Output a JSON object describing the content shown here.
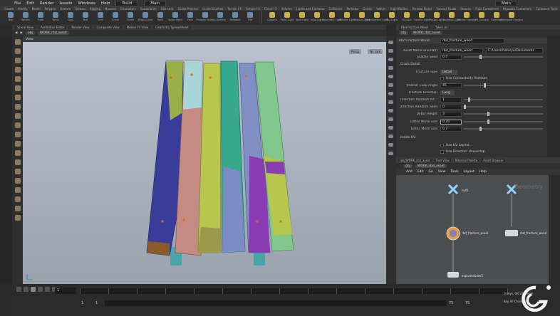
{
  "menubar": {
    "items": [
      "File",
      "Edit",
      "Render",
      "Assets",
      "Windows",
      "Help"
    ],
    "desktop": "Build",
    "context": "Main",
    "right_context": "Main"
  },
  "shelf_tabs": [
    "Create",
    "Modify",
    "Model",
    "Polygon",
    "Deform",
    "Texture",
    "Rigging",
    "Muscles",
    "Characters",
    "Constraints",
    "Hair Utils",
    "Guide Process",
    "Guide Brushes",
    "Terrain FX",
    "Simple FX",
    "Cloud FX",
    "Volume",
    "Lights and Cameras",
    "Collisions",
    "Particles",
    "Grains",
    "Vellum",
    "Rigid Bodies",
    "Particle Fluids",
    "Viscous Fluids",
    "Oceans",
    "Fluid Containers",
    "Populate Containers",
    "Container Tools",
    "Pyro FX",
    "Sparse Pyro FX",
    "FEM",
    "Wires",
    "Crowds",
    "Drive Simulation"
  ],
  "shelf_tools": [
    "Box",
    "Sphere",
    "Tube",
    "Torus",
    "Grid",
    "Null",
    "Line",
    "Circle",
    "Curve",
    "Draw Curve",
    "Path",
    "Spray Paint",
    "Font",
    "Platonic Solids",
    "L-System",
    "Metaball",
    "File"
  ],
  "light_tools": [
    "Camera",
    "Point Light",
    "Spot Light",
    "Area Light",
    "Geometry Light",
    "Volume Light",
    "Distant Light",
    "Environment Light",
    "Sky Light",
    "GI Light",
    "Caustic Light",
    "Portal Light",
    "Ambient Light",
    "Stereo Camera",
    "VR Camera",
    "Switcher",
    "Gamepad Camera"
  ],
  "pane_tabs": [
    "Scene View",
    "Animation Editor",
    "Render View",
    "Composite View",
    "Motion FX View",
    "Geometry Spreadsheet"
  ],
  "viewport": {
    "path": [
      "obj",
      "WORK_rbd_asset"
    ],
    "label": "View",
    "persp": "Persp",
    "cam": "No cam"
  },
  "params": {
    "tabs": [
      "Rbd Fracture Wood",
      "Take List"
    ],
    "node_type": "Rbd Fracture Wood",
    "node_name": "rbd_fracture_wood",
    "path_label": "Asset Name and Path",
    "path_value": "rbd_fracture_wood",
    "path_extra": "C:/Users/hataryo/Documents",
    "scatter_seed_label": "Scatter Seed",
    "scatter_seed": "0.7",
    "crack_section": "Crack Detail",
    "fracture_type_label": "Fracture Type",
    "fracture_type": "Detail",
    "connectivity_label": "Use Connectivity Partition",
    "cusp_label": "Interior Cusp Angle",
    "cusp": "45",
    "direction_label": "Fracture Direction",
    "direction": "Long",
    "rand_int_label": "Direction Random Int...",
    "rand_int": "1",
    "rand_seed_label": "Direction Random Seed",
    "rand_seed": "0",
    "height_label": "Detail Height",
    "height": "3",
    "noise_label": "Detail Noise Size",
    "noise": "0.35",
    "mesh_label": "Detail Mesh Size",
    "mesh": "0.7",
    "inside_section": "Inside UV",
    "uv_layout_label": "Use UV Layout",
    "uv_dir_label": "Use Direction Unoverlap"
  },
  "net": {
    "tabs": [
      "/obj/WORK_rbd_asset",
      "Tree View",
      "Material Palette",
      "Asset Browser"
    ],
    "path": [
      "obj",
      "WORK_rbd_asset"
    ],
    "menu": [
      "Add",
      "Edit",
      "Go",
      "View",
      "Tools",
      "Layout",
      "Help"
    ],
    "watermark": "Geometry",
    "nodes": {
      "null1": "null1",
      "fracture": "rbd_fracture_wood",
      "fracture2": "rbd_fracture_wood",
      "explode": "explodedview1"
    }
  },
  "timeline": {
    "frame": "1",
    "start": "1",
    "end": "1",
    "range_end": "75",
    "range_end2": "75",
    "keys": "0 keys, 0/0 channels",
    "key_all": "Key All Channels"
  },
  "colors": {
    "boards": [
      "#3a3c9a",
      "#c48b82",
      "#b6c64f",
      "#36a98f",
      "#8090c4",
      "#82c88c"
    ]
  }
}
